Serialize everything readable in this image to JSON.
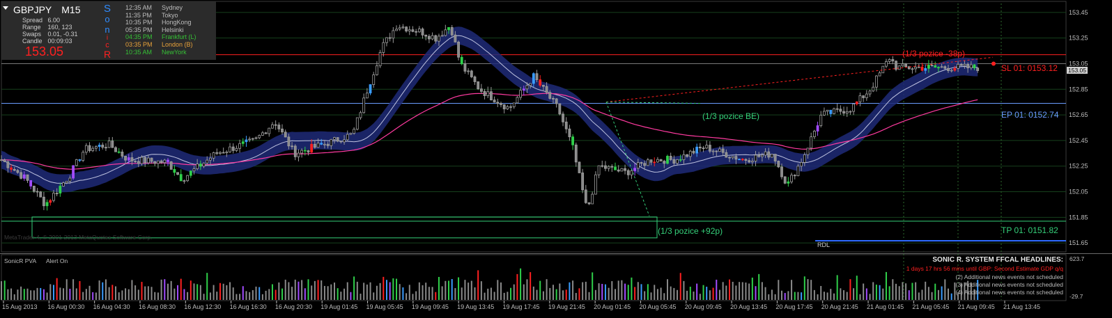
{
  "panel": {
    "symbol": "GBPJPY",
    "timeframe": "M15",
    "stats": [
      {
        "label": "Spread",
        "value": "6.00"
      },
      {
        "label": "Range",
        "value": "160, 123"
      },
      {
        "label": "Swaps",
        "value": "0.01, -0.31"
      },
      {
        "label": "Candle",
        "value": "00:09:03"
      }
    ],
    "bid": "153.05",
    "sonic_letters": [
      "S",
      "o",
      "n",
      "i",
      "c",
      "R"
    ],
    "sessions": [
      {
        "time": "12:35 AM",
        "city": "Sydney",
        "color": "#bdbdbd"
      },
      {
        "time": "11:35 PM",
        "city": "Tokyo",
        "color": "#bdbdbd"
      },
      {
        "time": "10:35 PM",
        "city": "HongKong",
        "color": "#bdbdbd"
      },
      {
        "time": "05:35 PM",
        "city": "Helsinki",
        "color": "#bdbdbd"
      },
      {
        "time": "04:35 PM",
        "city": "Frankfurt  (L)",
        "color": "#36c036"
      },
      {
        "time": "03:35 PM",
        "city": "London  (B)",
        "color": "#e8a23a"
      },
      {
        "time": "10:35 AM",
        "city": "NewYork",
        "color": "#36c036"
      }
    ]
  },
  "annotations": {
    "sl_note": "(1/3 pozice -38p)",
    "be_note": "(1/3 pozice BE)",
    "tp_note": "(1/3 pozice +92p)",
    "sl_label": "SL 01:  0153.12",
    "ep_label": "EP 01:  0152.74",
    "tp_label": "TP 01:  0151.82",
    "rdl": "RDL",
    "price_badge": "153.05",
    "copyright": "MetaTrader 4, © 2001-2013 MetaQuotes Software Corp."
  },
  "indicator": {
    "name": "SonicR PVA",
    "alert": "Alert On",
    "max_label": "623.7",
    "min_label": "-29.7"
  },
  "news": {
    "title": "SONIC R. SYSTEM  FFCAL HEADLINES:",
    "lines": [
      {
        "text": "1 days 17 hrs 56 mins until GBP: Second Estimate GDP q/q",
        "color": "#ff2020"
      },
      {
        "text": "(2)  Additional news events not scheduled",
        "color": "#bdbdbd"
      },
      {
        "text": "(3)  Additional news events not scheduled",
        "color": "#bdbdbd"
      },
      {
        "text": "(4)  Additional news events not scheduled",
        "color": "#bdbdbd"
      }
    ]
  },
  "colors": {
    "sl": "#ff2020",
    "ep": "#6a9cff",
    "tp": "#35d07a",
    "dragon": "#1e2a78",
    "ema": "#ff3aa0"
  },
  "chart_data": {
    "type": "candlestick",
    "symbol": "GBPJPY",
    "timeframe": "M15",
    "ylim": [
      151.58,
      153.52
    ],
    "y_ticks": [
      "153.45",
      "153.25",
      "153.05",
      "152.85",
      "152.65",
      "152.45",
      "152.25",
      "152.05",
      "151.85",
      "151.65"
    ],
    "x_ticks": [
      "15 Aug 2013",
      "16 Aug 00:30",
      "16 Aug 04:30",
      "16 Aug 08:30",
      "16 Aug 12:30",
      "16 Aug 16:30",
      "16 Aug 20:30",
      "19 Aug 01:45",
      "19 Aug 05:45",
      "19 Aug 09:45",
      "19 Aug 13:45",
      "19 Aug 17:45",
      "19 Aug 21:45",
      "20 Aug 01:45",
      "20 Aug 05:45",
      "20 Aug 09:45",
      "20 Aug 13:45",
      "20 Aug 17:45",
      "20 Aug 21:45",
      "21 Aug 01:45",
      "21 Aug 05:45",
      "21 Aug 09:45",
      "21 Aug 13:45"
    ],
    "current_price": 153.05,
    "levels": {
      "sl": 153.12,
      "ep": 152.74,
      "tp": 151.82
    },
    "close_path": [
      {
        "x": 0,
        "y": 152.3
      },
      {
        "x": 0.025,
        "y": 152.15
      },
      {
        "x": 0.045,
        "y": 151.95
      },
      {
        "x": 0.07,
        "y": 152.18
      },
      {
        "x": 0.085,
        "y": 152.38
      },
      {
        "x": 0.11,
        "y": 152.42
      },
      {
        "x": 0.13,
        "y": 152.3
      },
      {
        "x": 0.17,
        "y": 152.28
      },
      {
        "x": 0.185,
        "y": 152.15
      },
      {
        "x": 0.22,
        "y": 152.35
      },
      {
        "x": 0.26,
        "y": 152.45
      },
      {
        "x": 0.28,
        "y": 152.6
      },
      {
        "x": 0.3,
        "y": 152.35
      },
      {
        "x": 0.33,
        "y": 152.42
      },
      {
        "x": 0.36,
        "y": 152.5
      },
      {
        "x": 0.375,
        "y": 152.85
      },
      {
        "x": 0.39,
        "y": 153.18
      },
      {
        "x": 0.405,
        "y": 153.35
      },
      {
        "x": 0.43,
        "y": 153.3
      },
      {
        "x": 0.445,
        "y": 153.25
      },
      {
        "x": 0.46,
        "y": 153.35
      },
      {
        "x": 0.47,
        "y": 153.05
      },
      {
        "x": 0.49,
        "y": 152.85
      },
      {
        "x": 0.52,
        "y": 152.7
      },
      {
        "x": 0.545,
        "y": 152.95
      },
      {
        "x": 0.57,
        "y": 152.7
      },
      {
        "x": 0.585,
        "y": 152.4
      },
      {
        "x": 0.6,
        "y": 151.9
      },
      {
        "x": 0.612,
        "y": 152.25
      },
      {
        "x": 0.64,
        "y": 152.2
      },
      {
        "x": 0.665,
        "y": 152.3
      },
      {
        "x": 0.69,
        "y": 152.3
      },
      {
        "x": 0.72,
        "y": 152.4
      },
      {
        "x": 0.76,
        "y": 152.3
      },
      {
        "x": 0.79,
        "y": 152.35
      },
      {
        "x": 0.805,
        "y": 152.1
      },
      {
        "x": 0.82,
        "y": 152.3
      },
      {
        "x": 0.84,
        "y": 152.65
      },
      {
        "x": 0.87,
        "y": 152.7
      },
      {
        "x": 0.89,
        "y": 152.85
      },
      {
        "x": 0.91,
        "y": 153.1
      },
      {
        "x": 0.917,
        "y": 153.02
      }
    ],
    "volume_range": [
      -29.7,
      623.7
    ]
  }
}
